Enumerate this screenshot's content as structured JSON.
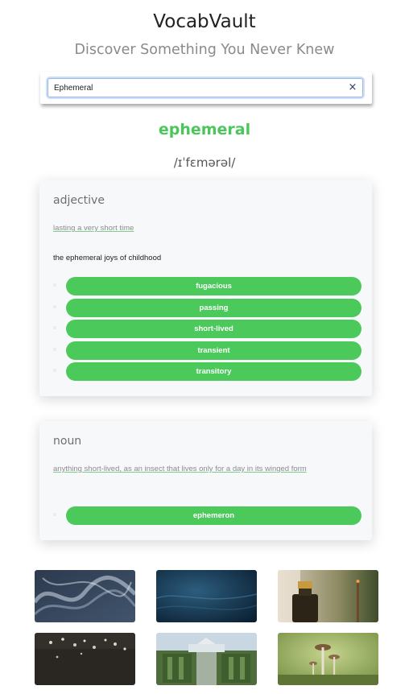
{
  "header": {
    "title": "VocabVault",
    "subtitle": "Discover Something You Never Knew"
  },
  "search": {
    "value": "Ephemeral",
    "clear_icon": "×"
  },
  "word": {
    "text": "ephemeral",
    "phonetic": "/ɪˈfɛmərəl/"
  },
  "meanings": [
    {
      "part_of_speech": "adjective",
      "definition": "lasting a very short time",
      "example": "the ephemeral joys of childhood",
      "synonyms": [
        "fugacious",
        "passing",
        "short-lived",
        "transient",
        "transitory"
      ]
    },
    {
      "part_of_speech": "noun",
      "definition": "anything short-lived, as an insect that lives only for a day in its winged form",
      "example": "",
      "synonyms": [
        "ephemeron"
      ]
    }
  ],
  "gallery": {
    "images": [
      {
        "subject": "smoke-photo"
      },
      {
        "subject": "dark-water-photo"
      },
      {
        "subject": "bottle-incense-photo"
      },
      {
        "subject": "soil-sprouts-photo"
      },
      {
        "subject": "greenhouse-garden-photo"
      },
      {
        "subject": "mushrooms-photo"
      }
    ]
  },
  "colors": {
    "accent": "#4bc65b",
    "card_bg": "#f6f8fa",
    "title": "#222222",
    "subtitle": "#8a8a8a"
  }
}
